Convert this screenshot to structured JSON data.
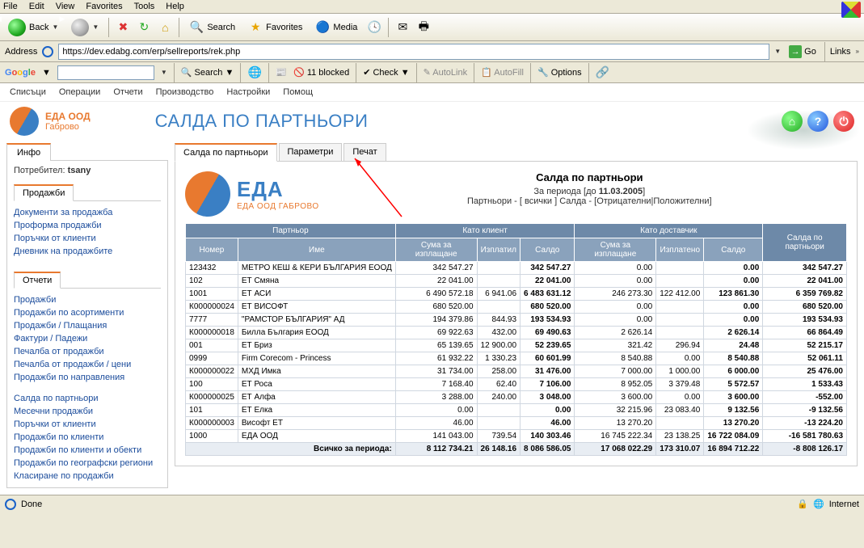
{
  "browser": {
    "menu": [
      "File",
      "Edit",
      "View",
      "Favorites",
      "Tools",
      "Help"
    ],
    "back": "Back",
    "search": "Search",
    "favorites": "Favorites",
    "media": "Media",
    "address_label": "Address",
    "url": "https://dev.edabg.com/erp/sellreports/rek.php",
    "go": "Go",
    "links": "Links"
  },
  "google": {
    "label_parts": [
      "G",
      "o",
      "o",
      "g",
      "l",
      "e"
    ],
    "search": "Search",
    "blocked": "11 blocked",
    "check": "Check",
    "autolink": "AutoLink",
    "autofill": "AutoFill",
    "options": "Options"
  },
  "app": {
    "menu": [
      "Списъци",
      "Операции",
      "Отчети",
      "Производство",
      "Настройки",
      "Помощ"
    ],
    "company1": "ЕДА ООД",
    "company2": "Габрово",
    "title": "САЛДА ПО ПАРТНЬОРИ"
  },
  "sidebar": {
    "info_tab": "Инфо",
    "user_label": "Потребител:",
    "user": "tsany",
    "section_sales": "Продажби",
    "sales_links": [
      "Документи за продажба",
      "Проформа продажби",
      "Поръчки от клиенти",
      "Дневник на продажбите"
    ],
    "section_reports": "Отчети",
    "report_links1": [
      "Продажби",
      "Продажби по асортименти",
      "Продажби / Плащания",
      "Фактури / Падежи",
      "Печалба от продажби",
      "Печалба от продажби / цени",
      "Продажби по направления"
    ],
    "report_links2": [
      "Салда по партньори",
      "Месечни продажби",
      "Поръчки от клиенти",
      "Продажби по клиенти",
      "Продажби по клиенти и обекти",
      "Продажби по географски региони",
      "Класиране по продажби"
    ]
  },
  "tabs": [
    "Салда по партньори",
    "Параметри",
    "Печат"
  ],
  "report": {
    "logo_top": "ЕДА",
    "logo_bottom": "ЕДА ООД ГАБРОВО",
    "title": "Салда по партньори",
    "period_prefix": "За периода [до ",
    "period_date": "11.03.2005",
    "period_suffix": "]",
    "filter": "Партньори - [ всички ] Салда - [Отрицателни|Положителни]"
  },
  "headers": {
    "partner": "Партньор",
    "as_client": "Като клиент",
    "as_supplier": "Като доставчик",
    "balance": "Салда по партньори",
    "num": "Номер",
    "name": "Име",
    "due_c": "Сума за изплащане",
    "paid_c": "Изплатил",
    "bal_c": "Салдо",
    "due_s": "Сума за изплащане",
    "paid_s": "Изплатено",
    "bal_s": "Салдо"
  },
  "rows": [
    {
      "num": "123432",
      "name": "МЕТРО КЕШ & КЕРИ БЪЛГАРИЯ ЕООД",
      "c_due": "342 547.27",
      "c_paid": "",
      "c_bal": "342 547.27",
      "s_due": "0.00",
      "s_paid": "",
      "s_bal": "0.00",
      "bal": "342 547.27"
    },
    {
      "num": "102",
      "name": "ЕТ Смяна",
      "c_due": "22 041.00",
      "c_paid": "",
      "c_bal": "22 041.00",
      "s_due": "0.00",
      "s_paid": "",
      "s_bal": "0.00",
      "bal": "22 041.00"
    },
    {
      "num": "1001",
      "name": "ЕТ АСИ",
      "c_due": "6 490 572.18",
      "c_paid": "6 941.06",
      "c_bal": "6 483 631.12",
      "s_due": "246 273.30",
      "s_paid": "122 412.00",
      "s_bal": "123 861.30",
      "bal": "6 359 769.82"
    },
    {
      "num": "К000000024",
      "name": "ЕТ ВИСОФТ",
      "c_due": "680 520.00",
      "c_paid": "",
      "c_bal": "680 520.00",
      "s_due": "0.00",
      "s_paid": "",
      "s_bal": "0.00",
      "bal": "680 520.00"
    },
    {
      "num": "7777",
      "name": "\"РАМСТОР БЪЛГАРИЯ\" АД",
      "c_due": "194 379.86",
      "c_paid": "844.93",
      "c_bal": "193 534.93",
      "s_due": "0.00",
      "s_paid": "",
      "s_bal": "0.00",
      "bal": "193 534.93"
    },
    {
      "num": "К000000018",
      "name": "Билла България ЕООД",
      "c_due": "69 922.63",
      "c_paid": "432.00",
      "c_bal": "69 490.63",
      "s_due": "2 626.14",
      "s_paid": "",
      "s_bal": "2 626.14",
      "bal": "66 864.49"
    },
    {
      "num": "001",
      "name": "ЕТ Бриз",
      "c_due": "65 139.65",
      "c_paid": "12 900.00",
      "c_bal": "52 239.65",
      "s_due": "321.42",
      "s_paid": "296.94",
      "s_bal": "24.48",
      "bal": "52 215.17"
    },
    {
      "num": "0999",
      "name": "Firm Corecom - Princess",
      "c_due": "61 932.22",
      "c_paid": "1 330.23",
      "c_bal": "60 601.99",
      "s_due": "8 540.88",
      "s_paid": "0.00",
      "s_bal": "8 540.88",
      "bal": "52 061.11"
    },
    {
      "num": "К000000022",
      "name": "МХД Имка",
      "c_due": "31 734.00",
      "c_paid": "258.00",
      "c_bal": "31 476.00",
      "s_due": "7 000.00",
      "s_paid": "1 000.00",
      "s_bal": "6 000.00",
      "bal": "25 476.00"
    },
    {
      "num": "100",
      "name": "ЕТ Роса",
      "c_due": "7 168.40",
      "c_paid": "62.40",
      "c_bal": "7 106.00",
      "s_due": "8 952.05",
      "s_paid": "3 379.48",
      "s_bal": "5 572.57",
      "bal": "1 533.43"
    },
    {
      "num": "К000000025",
      "name": "ЕТ Алфа",
      "c_due": "3 288.00",
      "c_paid": "240.00",
      "c_bal": "3 048.00",
      "s_due": "3 600.00",
      "s_paid": "0.00",
      "s_bal": "3 600.00",
      "bal": "-552.00"
    },
    {
      "num": "101",
      "name": "ЕТ Елка",
      "c_due": "0.00",
      "c_paid": "",
      "c_bal": "0.00",
      "s_due": "32 215.96",
      "s_paid": "23 083.40",
      "s_bal": "9 132.56",
      "bal": "-9 132.56"
    },
    {
      "num": "К000000003",
      "name": "Висофт ЕТ",
      "c_due": "46.00",
      "c_paid": "",
      "c_bal": "46.00",
      "s_due": "13 270.20",
      "s_paid": "",
      "s_bal": "13 270.20",
      "bal": "-13 224.20"
    },
    {
      "num": "1000",
      "name": "ЕДА ООД",
      "c_due": "141 043.00",
      "c_paid": "739.54",
      "c_bal": "140 303.46",
      "s_due": "16 745 222.34",
      "s_paid": "23 138.25",
      "s_bal": "16 722 084.09",
      "bal": "-16 581 780.63"
    }
  ],
  "total": {
    "label": "Всичко за периода:",
    "c_due": "8 112 734.21",
    "c_paid": "26 148.16",
    "c_bal": "8 086 586.05",
    "s_due": "17 068 022.29",
    "s_paid": "173 310.07",
    "s_bal": "16 894 712.22",
    "bal": "-8 808 126.17"
  },
  "status": {
    "done": "Done",
    "zone": "Internet"
  }
}
